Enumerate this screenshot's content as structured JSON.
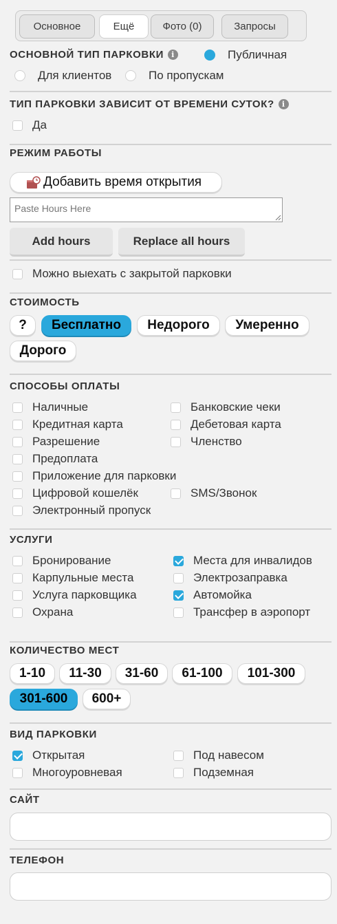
{
  "tabs": [
    "Основное",
    "Ещё",
    "Фото (0)",
    "Запросы"
  ],
  "parking_type": {
    "title": "ОСНОВНОЙ ТИП ПАРКОВКИ",
    "options": [
      "Публичная",
      "Для клиентов",
      "По пропускам"
    ],
    "selected": "Публичная"
  },
  "time_dependent": {
    "title": "ТИП ПАРКОВКИ ЗАВИСИТ ОТ ВРЕМЕНИ СУТОК?",
    "option": "Да"
  },
  "hours": {
    "title": "РЕЖИМ РАБОТЫ",
    "add_label": "Добавить время открытия",
    "paste_placeholder": "Paste Hours Here",
    "add_hours": "Add hours",
    "replace_hours": "Replace all hours",
    "exit_option": "Можно выехать с закрытой парковки"
  },
  "cost": {
    "title": "СТОИМОСТЬ",
    "options": [
      "?",
      "Бесплатно",
      "Недорого",
      "Умеренно",
      "Дорого"
    ],
    "selected": "Бесплатно"
  },
  "payment": {
    "title": "СПОСОБЫ ОПЛАТЫ",
    "left": [
      "Наличные",
      "Кредитная карта",
      "Разрешение",
      "Предоплата",
      "Приложение для парковки",
      "Цифровой кошелёк",
      "Электронный пропуск"
    ],
    "right": [
      "Банковские чеки",
      "Дебетовая карта",
      "Членство",
      "SMS/Звонок"
    ]
  },
  "services": {
    "title": "УСЛУГИ",
    "left": [
      "Бронирование",
      "Карпульные места",
      "Услуга парковщика",
      "Охрана"
    ],
    "right": [
      "Места для инвалидов",
      "Электрозаправка",
      "Автомойка",
      "Трансфер в аэропорт"
    ],
    "checked": [
      "Места для инвалидов",
      "Автомойка"
    ]
  },
  "spots": {
    "title": "КОЛИЧЕСТВО МЕСТ",
    "options": [
      "1-10",
      "11-30",
      "31-60",
      "61-100",
      "101-300",
      "301-600",
      "600+"
    ],
    "selected": "301-600"
  },
  "kind": {
    "title": "ВИД ПАРКОВКИ",
    "left": [
      "Открытая",
      "Многоуровневая"
    ],
    "right": [
      "Под навесом",
      "Подземная"
    ],
    "checked": [
      "Открытая"
    ]
  },
  "site": {
    "title": "САЙТ",
    "value": ""
  },
  "phone": {
    "title": "ТЕЛЕФОН",
    "value": ""
  },
  "colors": {
    "accent": "#2aa8dc",
    "background": "#f2f2f2"
  }
}
